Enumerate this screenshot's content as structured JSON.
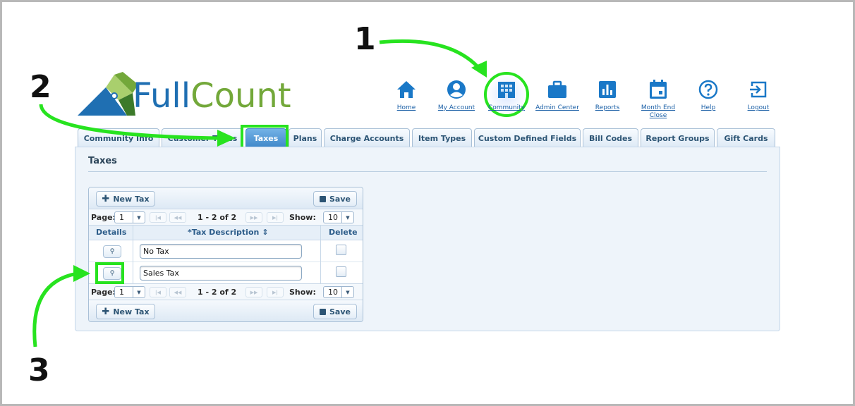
{
  "brand": {
    "name_part1": "Full",
    "name_part2": "Count",
    "colors": {
      "blue": "#1f6fb2",
      "green": "#73a83a",
      "dark_green": "#3c7a2a"
    }
  },
  "nav": {
    "items": [
      {
        "id": "home",
        "label": "Home",
        "icon": "home-icon"
      },
      {
        "id": "my-account",
        "label": "My Account",
        "icon": "user-circle-icon"
      },
      {
        "id": "community",
        "label": "Community",
        "icon": "building-icon"
      },
      {
        "id": "admin-center",
        "label": "Admin Center",
        "icon": "briefcase-icon"
      },
      {
        "id": "reports",
        "label": "Reports",
        "icon": "bar-chart-icon"
      },
      {
        "id": "month-end-close",
        "label_line1": "Month End",
        "label_line2": "Close",
        "icon": "calendar-icon"
      },
      {
        "id": "help",
        "label": "Help",
        "icon": "question-circle-icon"
      },
      {
        "id": "logout",
        "label": "Logout",
        "icon": "logout-icon"
      }
    ],
    "icon_color": "#1a78c7"
  },
  "tabs": [
    {
      "label": "Community Info"
    },
    {
      "label": "Customer Types"
    },
    {
      "label": "Taxes",
      "active": true
    },
    {
      "label": "Plans"
    },
    {
      "label": "Charge Accounts"
    },
    {
      "label": "Item Types"
    },
    {
      "label": "Custom Defined Fields"
    },
    {
      "label": "Bill Codes"
    },
    {
      "label": "Report Groups"
    },
    {
      "label": "Gift Cards"
    }
  ],
  "page": {
    "title": "Taxes"
  },
  "grid": {
    "new_button": "New Tax",
    "save_button": "Save",
    "pager": {
      "page_label": "Page:",
      "page_value": "1",
      "range": "1 - 2 of 2",
      "show_label": "Show:",
      "show_value": "10"
    },
    "columns": {
      "details": "Details",
      "description": "*Tax Description",
      "delete": "Delete"
    },
    "rows": [
      {
        "description": "No Tax"
      },
      {
        "description": "Sales Tax"
      }
    ]
  },
  "annotations": {
    "step1": "1",
    "step2": "2",
    "step3": "3",
    "color": "#27e31f"
  }
}
